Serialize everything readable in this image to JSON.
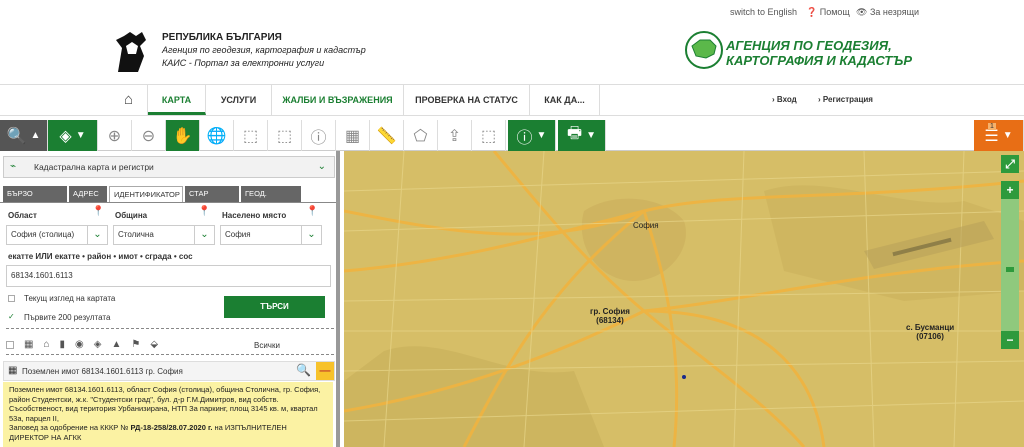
{
  "header": {
    "switch_lang": "switch to English",
    "help": "Помощ",
    "low_vision": "За незрящи",
    "org_line1": "РЕПУБЛИКА БЪЛГАРИЯ",
    "org_line2": "Агенция по геодезия, картография и кадастър",
    "org_line3": "КАИС - Портал за електронни услуги",
    "agency_logo_line1": "АГЕНЦИЯ ПО ГЕОДЕЗИЯ,",
    "agency_logo_line2": "КАРТОГРАФИЯ И КАДАСТЪР"
  },
  "nav": {
    "items": [
      "КАРТА",
      "УСЛУГИ",
      "ЖАЛБИ И ВЪЗРАЖЕНИЯ",
      "ПРОВЕРКА НА СТАТУС",
      "КАК ДА..."
    ],
    "login": "Вход",
    "register": "Регистрация"
  },
  "toolbar": {
    "orange_badge": "1"
  },
  "panel": {
    "layer_select": "Кадастрална карта и регистри",
    "tabs": [
      "БЪРЗО ТЪРСЕНЕ",
      "АДРЕС",
      "ИДЕНТИФИКАТОР",
      "СТАР ИДЕНТ.",
      "ГЕОД. ОСНОВА"
    ],
    "region_label": "Област",
    "region_value": "София (столица)",
    "municipality_label": "Община",
    "municipality_value": "Столична",
    "settlement_label": "Населено място",
    "settlement_value": "София",
    "id_label": "екатте ИЛИ екатте • район • имот • сграда • сос",
    "id_value": "68134.1601.6113",
    "current_view": "Текущ изглед на картата",
    "first_200": "Първите 200 резултата",
    "search_button": "ТЪРСИ",
    "all_label": "Всички",
    "result_title": "Поземлен имот 68134.1601.6113 гр. София",
    "result_body": "Поземлен имот 68134.1601.6113, област София (столица), община Столична, гр. София, район Студентски, ж.к. \"Студентски град\", бул. д-р Г.М.Димитров, вид собств. Съсобственост, вид територия Урбанизирана, НТП За паркинг, площ 3145 кв. м, квартал 53а, парцел II,",
    "result_order_prefix": "Заповед за одобрение на КККР №",
    "result_order_num": "РД-18-258/28.07.2020 г.",
    "result_order_suffix": "на ИЗПЪЛНИТЕЛЕН ДИРЕКТОР НА АГКК"
  },
  "map": {
    "city_center": "София",
    "sofia_label": "гр. София",
    "sofia_code": "(68134)",
    "busmantsi_label": "с. Бусманци",
    "busmantsi_code": "(07106)"
  }
}
